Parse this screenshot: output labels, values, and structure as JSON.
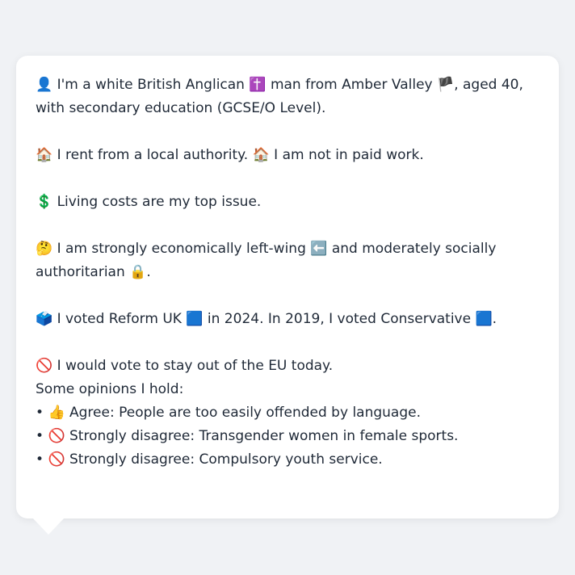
{
  "profile": {
    "identity": {
      "icon": "👤",
      "text_a": "I'm a white British Anglican",
      "icon_religion": "✝️",
      "text_b": "man from Amber Valley",
      "icon_flag": "🏴",
      "text_c": ", aged 40, with secondary education (GCSE/O Level)."
    },
    "housing": {
      "icon": "🏠",
      "text_a": "I rent from a local authority.",
      "icon_work": "🏠",
      "text_b": "I am not in paid work."
    },
    "issue": {
      "icon": "💲",
      "text": "Living costs are my top issue."
    },
    "politics": {
      "icon": "🤔",
      "text_a": "I am strongly economically left-wing",
      "icon_left": "⬅️",
      "text_b": "and moderately socially authoritarian",
      "icon_auth": "🔒",
      "text_c": "."
    },
    "vote": {
      "icon": "🗳️",
      "text_a": "I voted Reform UK",
      "icon_reform": "🟦",
      "text_b": "in 2024. In 2019, I voted Conservative",
      "icon_con": "🟦",
      "text_c": "."
    },
    "eu": {
      "icon": "🚫",
      "text": "I would vote to stay out of the EU today."
    },
    "opinions": {
      "title": "Some opinions I hold:",
      "items": [
        {
          "bullet": "•",
          "icon": "👍",
          "text": "Agree: People are too easily offended by language."
        },
        {
          "bullet": "•",
          "icon": "🚫",
          "text": "Strongly disagree: Transgender women in female sports."
        },
        {
          "bullet": "•",
          "icon": "🚫",
          "text": "Strongly disagree: Compulsory youth service."
        }
      ]
    }
  }
}
